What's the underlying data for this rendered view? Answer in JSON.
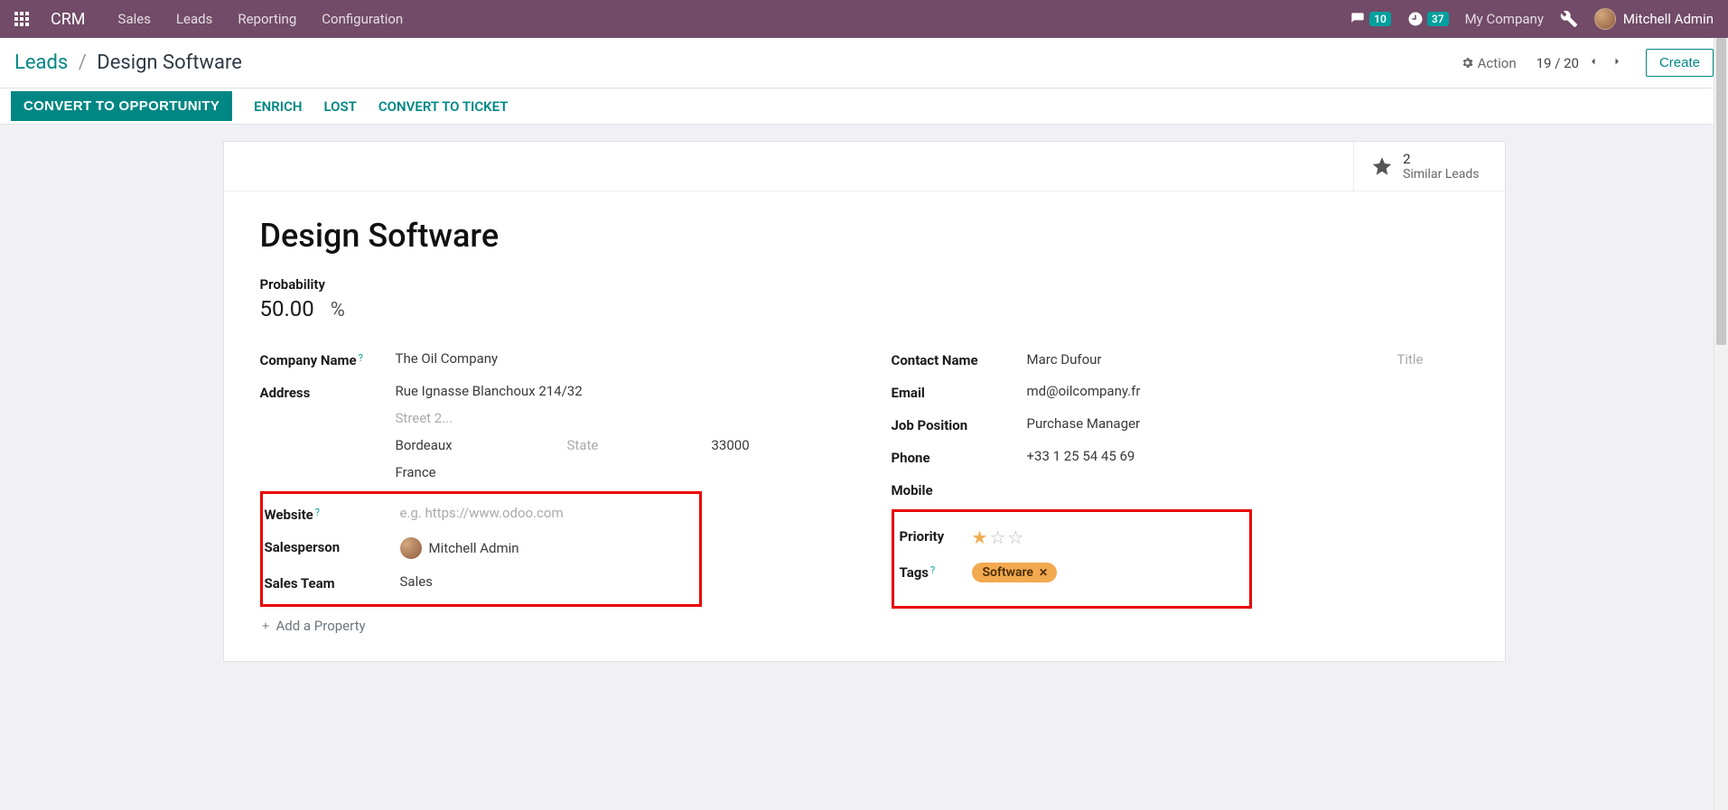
{
  "navbar": {
    "brand": "CRM",
    "menu": [
      "Sales",
      "Leads",
      "Reporting",
      "Configuration"
    ],
    "messages_badge": "10",
    "activities_badge": "37",
    "company": "My Company",
    "user": "Mitchell Admin"
  },
  "breadcrumb": {
    "parent": "Leads",
    "current": "Design Software"
  },
  "controls": {
    "action_label": "Action",
    "pager": "19 / 20",
    "create_label": "Create"
  },
  "status_buttons": {
    "convert_opportunity": "CONVERT TO OPPORTUNITY",
    "enrich": "ENRICH",
    "lost": "LOST",
    "convert_ticket": "CONVERT TO TICKET"
  },
  "stat_button": {
    "count": "2",
    "label": "Similar Leads"
  },
  "lead": {
    "title": "Design Software",
    "probability_label": "Probability",
    "probability_value": "50.00",
    "probability_unit": "%"
  },
  "left_fields": {
    "company_name_label": "Company Name",
    "company_name_value": "The Oil Company",
    "address_label": "Address",
    "street": "Rue Ignasse Blanchoux 214/32",
    "street2_placeholder": "Street 2...",
    "city": "Bordeaux",
    "state_placeholder": "State",
    "zip": "33000",
    "country": "France",
    "website_label": "Website",
    "website_placeholder": "e.g. https://www.odoo.com",
    "salesperson_label": "Salesperson",
    "salesperson_value": "Mitchell Admin",
    "salesteam_label": "Sales Team",
    "salesteam_value": "Sales"
  },
  "right_fields": {
    "contact_name_label": "Contact Name",
    "contact_name_value": "Marc Dufour",
    "contact_title_placeholder": "Title",
    "email_label": "Email",
    "email_value": "md@oilcompany.fr",
    "job_position_label": "Job Position",
    "job_position_value": "Purchase Manager",
    "phone_label": "Phone",
    "phone_value": "+33 1 25 54 45 69",
    "mobile_label": "Mobile",
    "priority_label": "Priority",
    "priority_stars_filled": 1,
    "tags_label": "Tags",
    "tag_value": "Software"
  },
  "add_property_label": "Add a Property"
}
